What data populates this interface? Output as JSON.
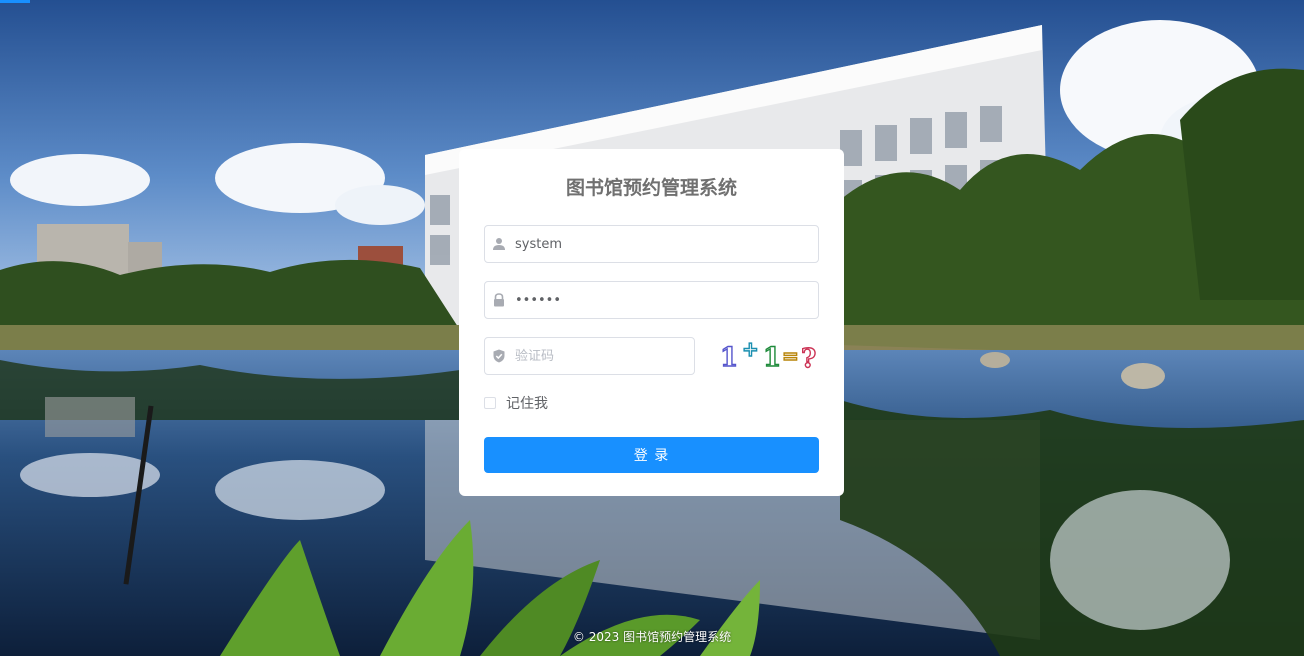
{
  "colors": {
    "primary": "#1890ff",
    "title_text": "#707070",
    "card_background": "#ffffff"
  },
  "login": {
    "title": "图书馆预约管理系统",
    "username": {
      "icon": "user-icon",
      "value": "system"
    },
    "password": {
      "icon": "lock-icon",
      "value": "123456"
    },
    "captcha": {
      "icon": "shield-check-icon",
      "placeholder": "验证码",
      "image_text": "1+1=?"
    },
    "remember_me": {
      "label": "记住我",
      "checked": false
    },
    "submit_label": "登 录"
  },
  "footer": {
    "copyright": "© 2023 图书馆预约管理系统"
  }
}
